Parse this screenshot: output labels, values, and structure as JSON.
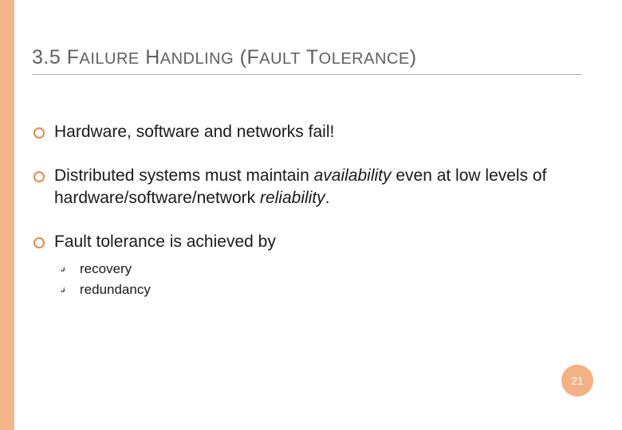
{
  "colors": {
    "accent": "#f4b48a",
    "badge": "#f4b183"
  },
  "title": {
    "section_number": "3.5",
    "text": "FAILURE HANDLING (FAULT TOLERANCE)"
  },
  "bullets": [
    {
      "text": "Hardware, software and networks fail!"
    },
    {
      "html": "Distributed systems must maintain <em>availability</em> even at low levels of hardware/software/network <em>reliability</em>."
    },
    {
      "text": "Fault tolerance is achieved by",
      "sub": [
        {
          "text": "recovery"
        },
        {
          "text": "redundancy"
        }
      ]
    }
  ],
  "page_number": "21"
}
